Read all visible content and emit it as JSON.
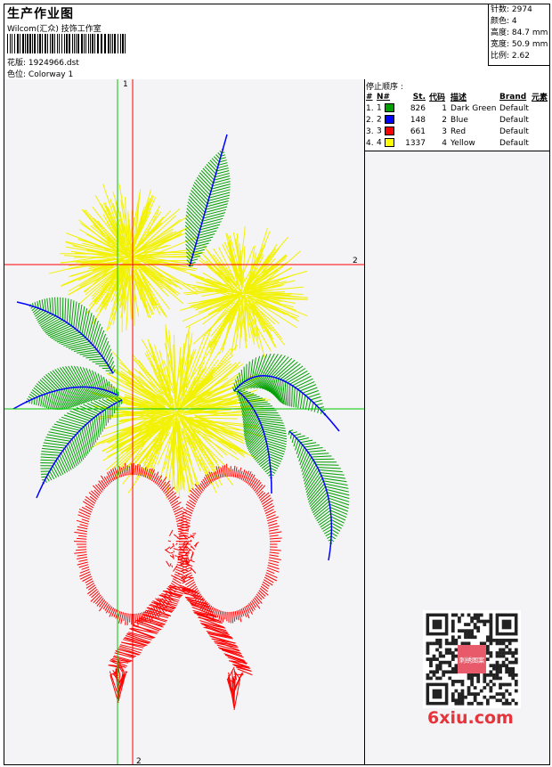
{
  "header": {
    "title": "生产作业图",
    "company": "Wilcom(汇众) 技饰工作室",
    "design_label": "花版:",
    "design_value": "1924966.dst",
    "colorway_label": "色位:",
    "colorway_value": "Colorway 1"
  },
  "stats": [
    {
      "label": "针数",
      "value": "2974"
    },
    {
      "label": "颜色",
      "value": "4"
    },
    {
      "label": "高度",
      "value": "84.7 mm"
    },
    {
      "label": "宽度",
      "value": "50.9 mm"
    },
    {
      "label": "比例",
      "value": "2.62"
    }
  ],
  "stop_sequence": {
    "title": "停止顺序 :",
    "columns": [
      "#",
      "N#",
      "St.",
      "代码",
      "描述",
      "Brand",
      "元素"
    ],
    "rows": [
      {
        "idx": "1.",
        "n": "1",
        "color": "#00a000",
        "st": "826",
        "code": "1",
        "desc": "Dark Green",
        "brand": "Default"
      },
      {
        "idx": "2.",
        "n": "2",
        "color": "#0000ff",
        "st": "148",
        "code": "2",
        "desc": "Blue",
        "brand": "Default"
      },
      {
        "idx": "3.",
        "n": "3",
        "color": "#ff0000",
        "st": "661",
        "code": "3",
        "desc": "Red",
        "brand": "Default"
      },
      {
        "idx": "4.",
        "n": "4",
        "color": "#ffff00",
        "st": "1337",
        "code": "4",
        "desc": "Yellow",
        "brand": "Default"
      }
    ]
  },
  "guides": {
    "v1": "1",
    "h2": "2",
    "v2": "2"
  },
  "watermark": "6xiu.com",
  "qr_center_text": "刺绣图案"
}
